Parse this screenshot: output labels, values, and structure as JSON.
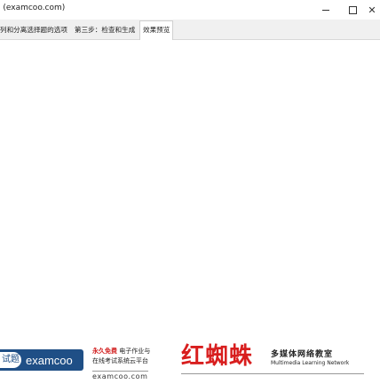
{
  "window": {
    "title": "i (examcoo.com)",
    "controls": {
      "minimize": "—",
      "maximize": "□",
      "close": "✕"
    }
  },
  "tabs": [
    {
      "label": "列和分离选择题的选项",
      "active": false
    },
    {
      "label": "第三步：检查和生成",
      "active": false
    },
    {
      "label": "效果预览",
      "active": true
    }
  ],
  "footer": {
    "examcoo_logo": {
      "badge": "试题",
      "word": "examcoo",
      "icon": "examcoo-logo-icon"
    },
    "promo": {
      "free": "永久免费",
      "line1_rest": "电子作业与",
      "line2": "在线考试系统云平台"
    },
    "url": "examcoo.com",
    "hongzhizhu": {
      "logo": "红蜘蛛",
      "caption_cn": "多媒体网络教室",
      "caption_en": "Multimedia Learning Network"
    }
  },
  "colors": {
    "brand_blue": "#1f4f86",
    "brand_red": "#d81e1e",
    "promo_red": "#d01818"
  }
}
